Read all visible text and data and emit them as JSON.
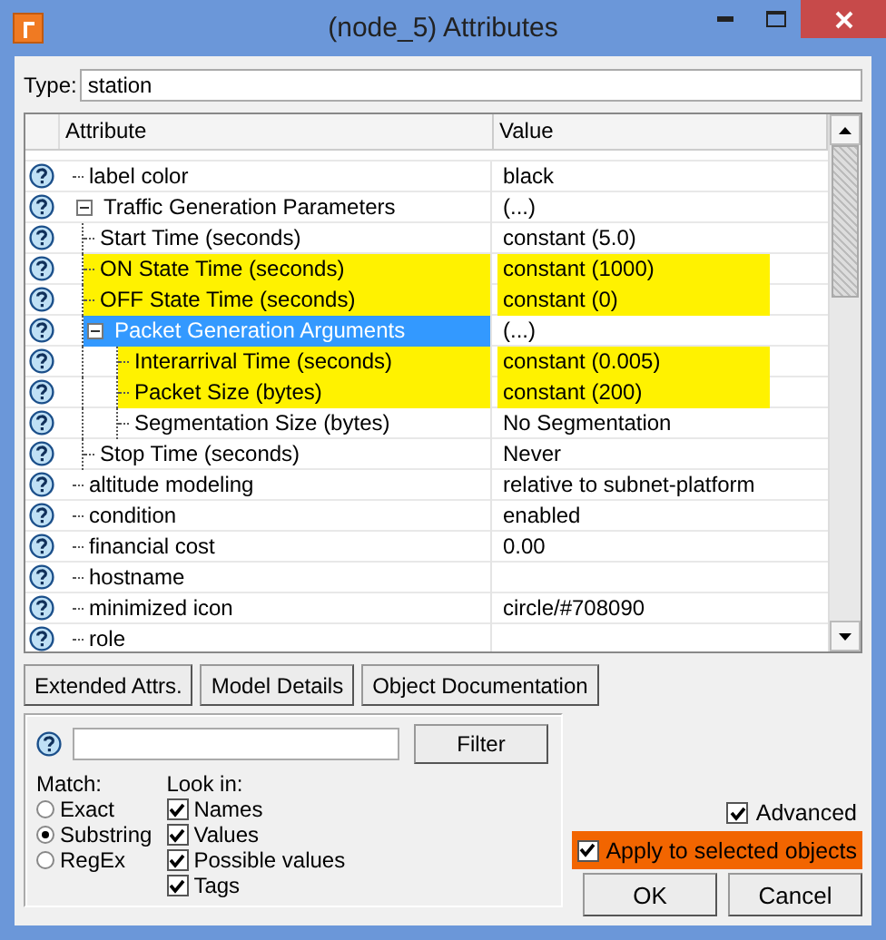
{
  "window": {
    "title": "(node_5) Attributes"
  },
  "type_field": {
    "label": "Type:",
    "value": "station"
  },
  "table": {
    "columns": [
      "Attribute",
      "Value"
    ],
    "rows": [
      {
        "name": "label color",
        "value": "black",
        "highlighted": false,
        "selected": false
      },
      {
        "name": "Traffic Generation Parameters",
        "value": "(...)",
        "highlighted": false,
        "selected": false,
        "expanded": true,
        "children": [
          {
            "name": "Start Time (seconds)",
            "value": "constant (5.0)",
            "highlighted": false,
            "selected": false
          },
          {
            "name": "ON State Time (seconds)",
            "value": "constant (1000)",
            "highlighted": true,
            "selected": false
          },
          {
            "name": "OFF State Time (seconds)",
            "value": "constant (0)",
            "highlighted": true,
            "selected": false
          },
          {
            "name": "Packet Generation Arguments",
            "value": "(...)",
            "highlighted": false,
            "selected": true,
            "expanded": true,
            "children": [
              {
                "name": "Interarrival Time (seconds)",
                "value": "constant (0.005)",
                "highlighted": true,
                "selected": false
              },
              {
                "name": "Packet Size (bytes)",
                "value": "constant (200)",
                "highlighted": true,
                "selected": false
              },
              {
                "name": "Segmentation Size (bytes)",
                "value": "No Segmentation",
                "highlighted": false,
                "selected": false
              }
            ]
          },
          {
            "name": "Stop Time (seconds)",
            "value": "Never",
            "highlighted": false,
            "selected": false
          }
        ]
      },
      {
        "name": "altitude modeling",
        "value": "relative to subnet-platform",
        "highlighted": false,
        "selected": false
      },
      {
        "name": "condition",
        "value": "enabled",
        "highlighted": false,
        "selected": false
      },
      {
        "name": "financial cost",
        "value": "0.00",
        "highlighted": false,
        "selected": false
      },
      {
        "name": "hostname",
        "highlighted": false,
        "selected": false
      },
      {
        "name": "minimized icon",
        "value": "circle/#708090",
        "highlighted": false,
        "selected": false
      },
      {
        "name": "role",
        "highlighted": false,
        "selected": false
      }
    ]
  },
  "buttons": [
    "Extended Attrs.",
    "Model Details",
    "Object Documentation"
  ],
  "filter": {
    "button": "Filter",
    "match_label": "Match:",
    "match": [
      {
        "label": "Exact",
        "selected": false
      },
      {
        "label": "Substring",
        "selected": true
      },
      {
        "label": "RegEx",
        "selected": false
      }
    ],
    "look_in_label": "Look in:",
    "look_in": [
      {
        "label": "Names",
        "checked": true
      },
      {
        "label": "Values",
        "checked": true
      },
      {
        "label": "Possible values",
        "checked": true
      },
      {
        "label": "Tags",
        "checked": true
      }
    ]
  },
  "advanced": {
    "label": "Advanced",
    "checked": true
  },
  "apply": {
    "label": "Apply to selected objects",
    "checked": true,
    "highlighted": true
  },
  "dialog_buttons": [
    "OK",
    "Cancel"
  ]
}
